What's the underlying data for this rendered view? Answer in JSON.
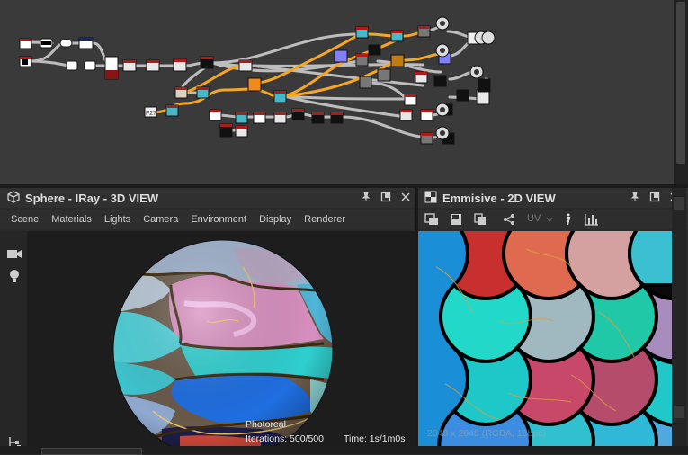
{
  "graph_editor": {
    "node_label": "F27"
  },
  "panel_3d": {
    "title": "Sphere - IRay - 3D VIEW",
    "menu": [
      "Scene",
      "Materials",
      "Lights",
      "Camera",
      "Environment",
      "Display",
      "Renderer"
    ],
    "render_mode": "Photoreal",
    "iterations": "Iterations: 500/500",
    "time": "Time: 1s/1m0s"
  },
  "panel_2d": {
    "title": "Emmisive - 2D VIEW",
    "uv_label": "UV",
    "resolution": "2048 x 2048 (RGBA, 16bpc)"
  },
  "colors": {
    "accent_orange": "#f5a623",
    "panel_bg": "#2a2a2a",
    "graph_bg": "#3a3a3a"
  }
}
